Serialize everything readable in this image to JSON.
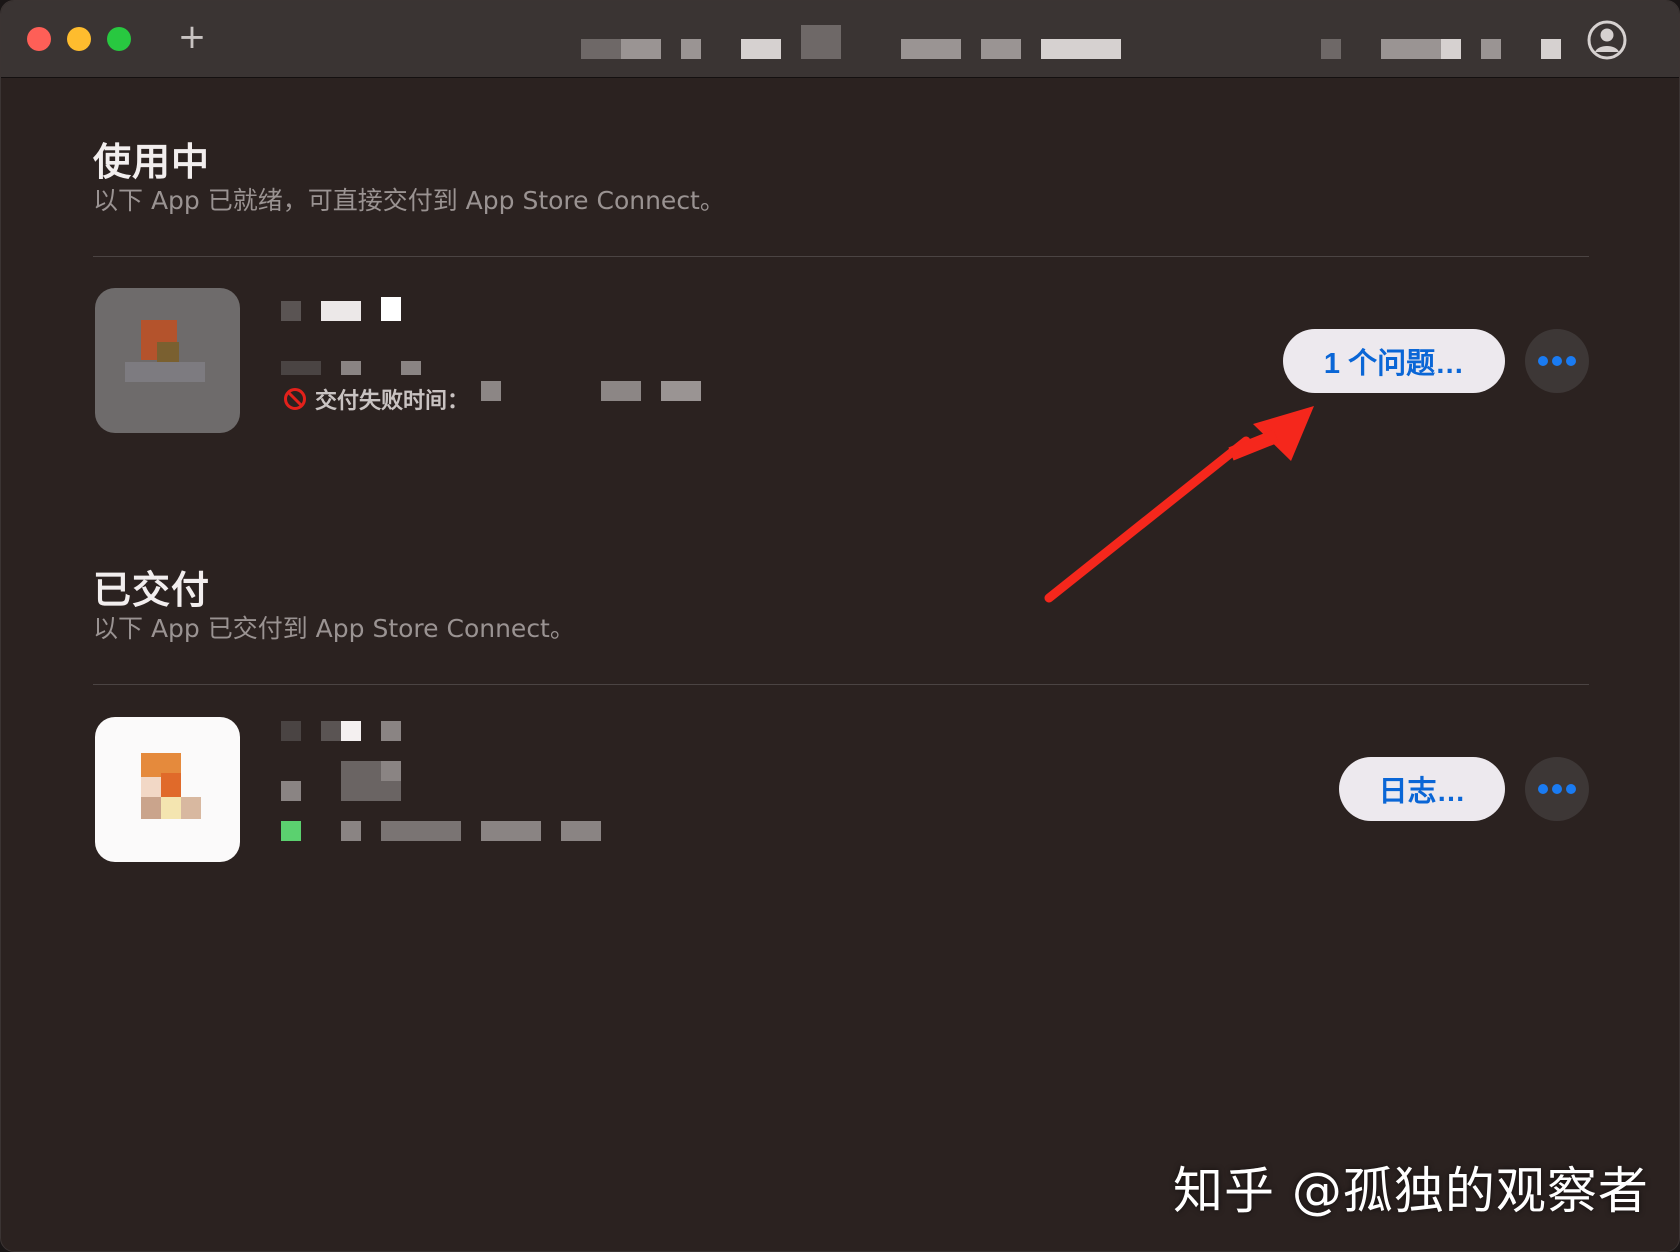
{
  "titlebar": {
    "new_tab_label": "+",
    "account_icon": "person-circle-icon"
  },
  "in_use": {
    "title": "使用中",
    "subtitle": "以下 App 已就绪，可直接交付到 App Store Connect。",
    "app": {
      "status_icon": "prohibited-icon",
      "status_label": "交付失败时间：",
      "issues_button": "1 个问题…",
      "more_label": "•••"
    }
  },
  "delivered": {
    "title": "已交付",
    "subtitle": "以下 App 已交付到 App Store Connect。",
    "app": {
      "log_button": "日志…",
      "more_label": "•••"
    }
  },
  "watermark": "知乎 @孤独的观察者",
  "colors": {
    "accent_blue": "#0a66d6",
    "fail_red": "#e3211b",
    "arrow_red": "#f5271c",
    "background": "#2b2220"
  }
}
